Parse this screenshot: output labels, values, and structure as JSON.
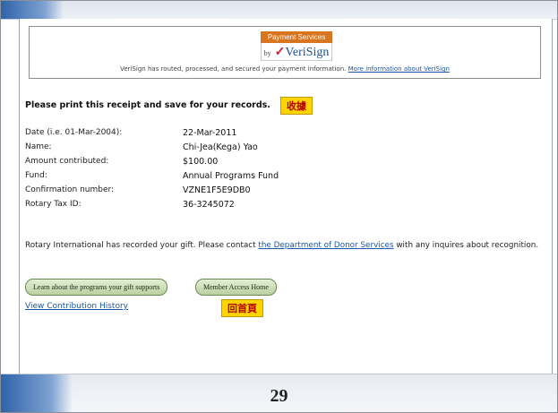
{
  "verisign": {
    "logo_top": "Payment Services",
    "logo_by": "by",
    "logo_name": "VeriSign",
    "note": "VeriSign has routed, processed, and secured your payment information.",
    "more_link": "More information about VeriSign"
  },
  "receipt": {
    "heading": "Please print this receipt and save for your records.",
    "tag": "收據"
  },
  "details": [
    {
      "label": "Date (i.e. 01-Mar-2004):",
      "value": "22-Mar-2011"
    },
    {
      "label": "Name:",
      "value": "Chi-Jea(Kega) Yao"
    },
    {
      "label": "Amount contributed:",
      "value": "$100.00"
    },
    {
      "label": "Fund:",
      "value": "Annual Programs Fund"
    },
    {
      "label": "Confirmation number:",
      "value": "VZNE1F5E9DB0"
    },
    {
      "label": "Rotary Tax ID:",
      "value": "36-3245072"
    }
  ],
  "recorded": {
    "prefix": "Rotary International has recorded your gift. Please contact",
    "link": "the Department of Donor Services",
    "suffix": "with any inquires about recognition."
  },
  "buttons": {
    "learn": "Learn about the programs your gift supports",
    "member": "Member Access Home"
  },
  "history_link": "View Contribution History",
  "home_tag": "回首頁",
  "slide_number": "29"
}
